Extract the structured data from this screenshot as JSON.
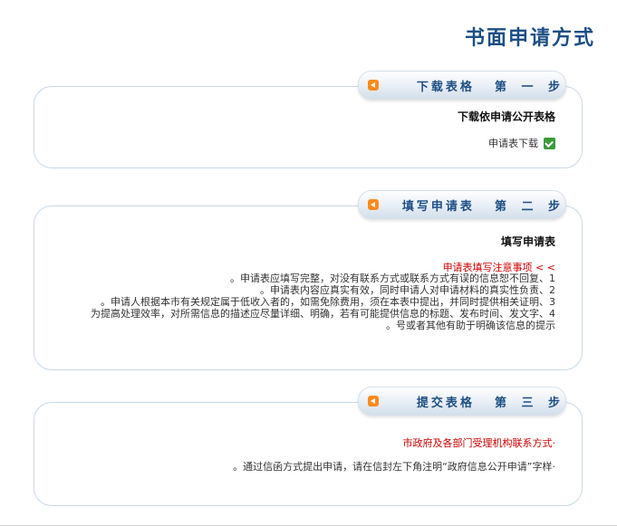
{
  "page": {
    "title": "书面申请方式"
  },
  "step1": {
    "number": "第 一 步",
    "name": "下载表格",
    "heading": "下载依申请公开表格",
    "download_label": "申请表下载"
  },
  "step2": {
    "number": "第 二 步",
    "name": "填写申请表",
    "heading": "填写申请表",
    "notes_title": "> > 申请表填写注意事项",
    "notes": [
      "1、申请表应填写完整，对没有联系方式或联系方式有误的信息恕不回复。",
      "2、申请表内容应真实有效，同时申请人对申请材料的真实性负责。",
      "3、申请人根据本市有关规定属于低收入者的，如需免除费用，须在本表中提出，并同时提供相关证明。",
      "4、为提高处理效率，对所需信息的描述应尽量详细、明确，若有可能提供信息的标题、发布时间、发文字",
      "号或者其他有助于明确该信息的提示。"
    ]
  },
  "step3": {
    "number": "第 三 步",
    "name": "提交表格",
    "red_link": "·市政府及各部门受理机构联系方式",
    "text": "·通过信函方式提出申请，请在信封左下角注明“政府信息公开申请”字样。"
  }
}
